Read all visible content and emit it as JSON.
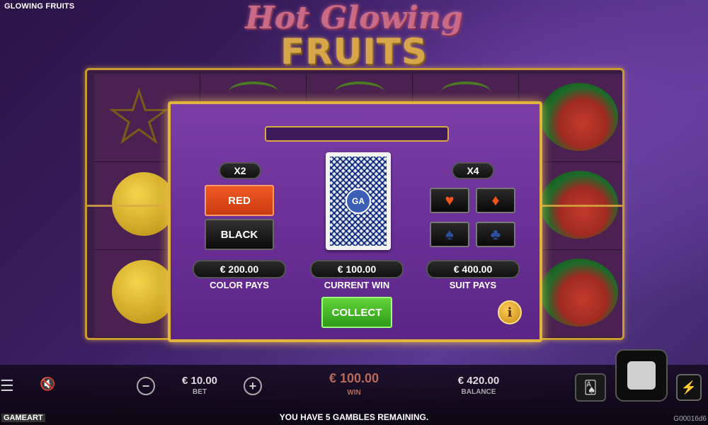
{
  "header": {
    "game_title": "GLOWING FRUITS",
    "logo_line1": "Hot Glowing",
    "logo_line2": "FRUITS"
  },
  "gamble": {
    "color_multiplier": "X2",
    "suit_multiplier": "X4",
    "red_label": "RED",
    "black_label": "BLACK",
    "card_logo": "GA",
    "color_pays_value": "€ 200.00",
    "color_pays_label": "COLOR PAYS",
    "current_win_value": "€ 100.00",
    "current_win_label": "CURRENT WIN",
    "suit_pays_value": "€ 400.00",
    "suit_pays_label": "SUIT PAYS",
    "collect_label": "COLLECT",
    "info_label": "i",
    "suits": [
      {
        "name": "hearts",
        "glyph": "♥",
        "color": "#f0541c"
      },
      {
        "name": "diamonds",
        "glyph": "♦",
        "color": "#f0541c"
      },
      {
        "name": "spades",
        "glyph": "♠",
        "color": "#2c4f9e"
      },
      {
        "name": "clubs",
        "glyph": "♣",
        "color": "#2c4f9e"
      }
    ]
  },
  "bottom_bar": {
    "bet_value": "€ 10.00",
    "bet_label": "BET",
    "win_value": "€ 100.00",
    "win_label": "WIN",
    "balance_value": "€ 420.00",
    "balance_label": "BALANCE",
    "minus_label": "−",
    "plus_label": "+",
    "menu_icon": "☰",
    "mute_icon": "🔇",
    "gamble_icon": "🂡",
    "turbo_icon": "⚡"
  },
  "footer": {
    "message": "YOU HAVE 5 GAMBLES REMAINING.",
    "brand": "GAMEART",
    "game_id": "G00016d6"
  },
  "colors": {
    "accent_gold": "#e3b43c",
    "red_button": "#f05a24",
    "collect_green": "#62d43a",
    "modal_purple": "#7a3ea6"
  }
}
